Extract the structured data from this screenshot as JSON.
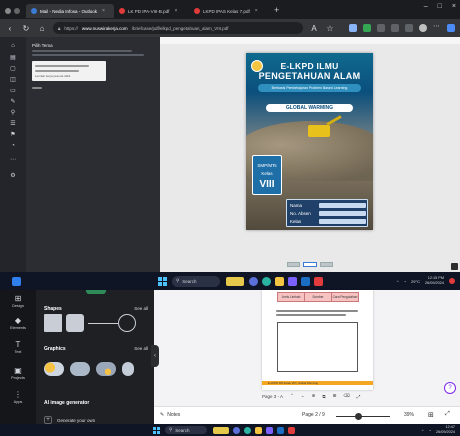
{
  "browser": {
    "tabs": [
      {
        "label": "Mail - Nedia Infosa - Outlook",
        "color": "#3a7bd5",
        "active": true
      },
      {
        "label": "LK PD IPA-VIII-B.pdf",
        "color": "#e23b3b",
        "active": false
      },
      {
        "label": "LKPD IPAS Kelas 7.pdf",
        "color": "#e23b3b",
        "active": false
      }
    ],
    "new_tab": "+",
    "win_ctrls": [
      "–",
      "□",
      "×"
    ],
    "url_prefix": "https://",
    "url_host": "www.nuswirakerja.com",
    "url_path": "/briefcase/pdf/elkpd_pengetahuan_alam_VIII.pdf"
  },
  "sidepanel": {
    "title": "Pilih Tema",
    "card_text": "Lembar kerja peserta didik"
  },
  "cover": {
    "title_line1": "E-LKPD ILMU",
    "title_line2": "PENGETAHUAN ALAM",
    "subtitle": "Berbasis Pembelajaran Problem Based Learning",
    "topic": "GLOBAL WARMING",
    "class_lines": [
      "SMP/MTs",
      "Kelas",
      "VIII"
    ],
    "form_labels": [
      "Nama",
      "No. Absen",
      "Kelas"
    ]
  },
  "taskbar1": {
    "search": "Search",
    "weather": "29°C",
    "time": "12:15 PM",
    "date": "26/09/2024"
  },
  "taskbar2": {
    "search": "Search",
    "time": "12:47",
    "date": "26/09/2024"
  },
  "editor": {
    "rail": [
      {
        "glyph": "⊞",
        "label": "Design"
      },
      {
        "glyph": "◆",
        "label": "Elements"
      },
      {
        "glyph": "T",
        "label": "Text"
      },
      {
        "glyph": "▣",
        "label": "Projects"
      },
      {
        "glyph": "⋮",
        "label": "Apps"
      }
    ],
    "shapes_title": "Shapes",
    "see_all": "See all",
    "graphics_title": "Graphics",
    "ai_title": "AI image generator",
    "ai_button": "Generate your own",
    "table_headers": [
      "Jenis Limbah",
      "Sumber",
      "Cara Pengolahan"
    ],
    "footer_text": "E-LKPD IPA Kelas VIII | Global Warming",
    "page_tools": "Page 3 - A",
    "notes": "Notes",
    "page_count": "Page 2 / 9",
    "zoom": "39%",
    "help": "?"
  }
}
